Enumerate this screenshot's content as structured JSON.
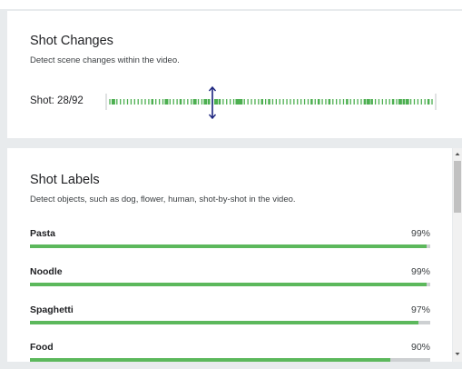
{
  "shot_changes": {
    "title": "Shot Changes",
    "subtitle": "Detect scene changes within the video.",
    "shot_label": "Shot: 28/92",
    "current_shot": 28,
    "total_shots": 92,
    "tick_color": "#4caf50",
    "scrubber_color": "#1a237e"
  },
  "shot_labels": {
    "title": "Shot Labels",
    "subtitle": "Detect objects, such as dog, flower, human, shot-by-shot in the video.",
    "items": [
      {
        "name": "Pasta",
        "percent_label": "99%",
        "confidence": 0.99
      },
      {
        "name": "Noodle",
        "percent_label": "99%",
        "confidence": 0.99
      },
      {
        "name": "Spaghetti",
        "percent_label": "97%",
        "confidence": 0.97
      },
      {
        "name": "Food",
        "percent_label": "90%",
        "confidence": 0.9
      }
    ],
    "bar_color": "#5cb85c",
    "track_color": "#cdd0d2"
  },
  "scrollbar": {
    "up_icon": "triangle-up-icon",
    "down_icon": "triangle-down-icon"
  }
}
